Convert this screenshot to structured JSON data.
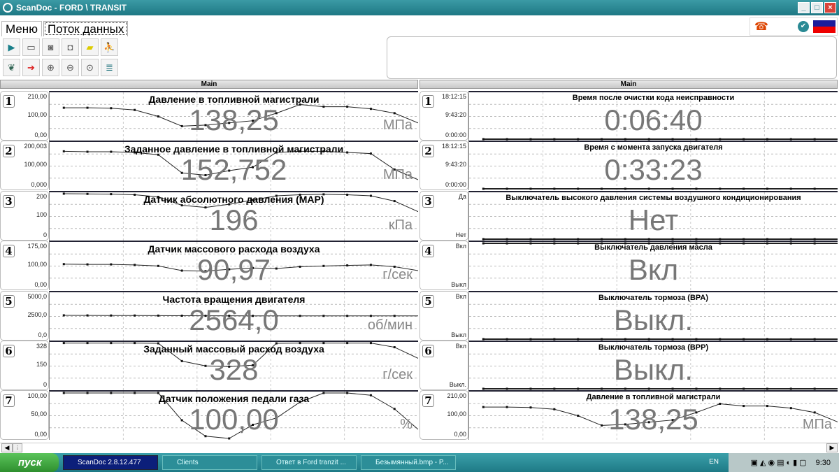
{
  "window": {
    "title": "ScanDoc - FORD \\ TRANSIT",
    "min": "_",
    "max": "□",
    "close": "×"
  },
  "tabs": [
    {
      "label": "Меню"
    },
    {
      "label": "Поток данных"
    }
  ],
  "toolbar1": [
    "play-icon",
    "save-icon",
    "record-icon",
    "camera-icon",
    "open-folder-icon",
    "person-icon"
  ],
  "toolbar2": [
    "leaf-icon",
    "export-icon",
    "zoom-in-icon",
    "zoom-out-icon",
    "zoom-fit-icon",
    "list-icon"
  ],
  "status": {
    "colors": {
      "flag_top": "#1c1c9c",
      "flag_bottom": "#e00000"
    }
  },
  "left": {
    "header": "Main",
    "panels": [
      {
        "n": "1",
        "title": "Давление в топливной магистрали",
        "value": "138,25",
        "unit": "МПа",
        "axis": [
          "210,00",
          "100,00",
          "0,00"
        ],
        "ymin": 0,
        "ymax": 210,
        "trace": [
          145,
          145,
          143,
          135,
          105,
          60,
          65,
          75,
          85,
          120,
          160,
          150,
          150,
          140,
          120,
          75
        ]
      },
      {
        "n": "2",
        "title": "Заданное давление в топливной магистрали",
        "value": "152,752",
        "unit": "МПа",
        "axis": [
          "200,003",
          "100,000",
          "0,000"
        ],
        "ymin": 0,
        "ymax": 200,
        "trace": [
          165,
          163,
          163,
          160,
          150,
          70,
          60,
          80,
          95,
          160,
          165,
          165,
          160,
          155,
          85,
          40
        ]
      },
      {
        "n": "3",
        "title": "Датчик абсолютного давления (MAP)",
        "value": "196",
        "unit": "кПа",
        "axis": [
          "200",
          "100",
          "0"
        ],
        "ymin": 0,
        "ymax": 215,
        "trace": [
          215,
          214,
          213,
          210,
          200,
          160,
          150,
          165,
          185,
          205,
          210,
          212,
          210,
          205,
          180,
          130
        ]
      },
      {
        "n": "4",
        "title": "Датчик массового расхода воздуха",
        "value": "90,97",
        "unit": "г/сек",
        "axis": [
          "175,00",
          "100,00",
          "0,00"
        ],
        "ymin": 0,
        "ymax": 175,
        "trace": [
          95,
          94,
          94,
          92,
          88,
          70,
          68,
          75,
          80,
          78,
          85,
          88,
          90,
          92,
          85,
          70
        ]
      },
      {
        "n": "5",
        "title": "Частота вращения двигателя",
        "value": "2564,0",
        "unit": "об/мин",
        "axis": [
          "5000,0",
          "2500,0",
          "0,0"
        ],
        "ymin": 0,
        "ymax": 5000,
        "trace": [
          2620,
          2610,
          2600,
          2600,
          2590,
          2580,
          2570,
          2570,
          2560,
          2560,
          2560,
          2560,
          2560,
          2560,
          2560,
          2560
        ]
      },
      {
        "n": "6",
        "title": "Заданный массовый расход воздуха",
        "value": "328",
        "unit": "г/сек",
        "axis": [
          "328",
          "150",
          "0"
        ],
        "ymin": 0,
        "ymax": 328,
        "trace": [
          330,
          330,
          330,
          330,
          328,
          200,
          165,
          160,
          170,
          328,
          330,
          330,
          330,
          330,
          300,
          220
        ]
      },
      {
        "n": "7",
        "title": "Датчик положения педали газа",
        "value": "100,00",
        "unit": "%",
        "axis": [
          "100,00",
          "50,00",
          "0,00"
        ],
        "ymin": 0,
        "ymax": 100,
        "trace": [
          100,
          100,
          100,
          100,
          100,
          40,
          5,
          0,
          30,
          45,
          80,
          100,
          100,
          95,
          65,
          20
        ]
      }
    ]
  },
  "right": {
    "header": "Main",
    "panels": [
      {
        "n": "1",
        "title": "Время после очистки кода неисправности",
        "value": "0:06:40",
        "unit": "",
        "axis": [
          "18:12:15",
          "9:43:20",
          "0:00:00"
        ],
        "ymin": 0,
        "ymax": 1,
        "trace": [
          0,
          0,
          0,
          0,
          0,
          0,
          0,
          0,
          0,
          0,
          0,
          0,
          0,
          0,
          0,
          0
        ]
      },
      {
        "n": "2",
        "title": "Время с момента запуска двигателя",
        "value": "0:33:23",
        "unit": "",
        "axis": [
          "18:12:15",
          "9:43:20",
          "0:00:00"
        ],
        "ymin": 0,
        "ymax": 1,
        "trace": [
          0,
          0,
          0,
          0,
          0,
          0,
          0,
          0,
          0,
          0,
          0,
          0,
          0,
          0,
          0,
          0
        ]
      },
      {
        "n": "3",
        "title": "Выключатель высокого давления системы воздушного кондиционирования",
        "value": "Нет",
        "unit": "",
        "axis": [
          "Да",
          "",
          "Нет"
        ],
        "ymin": 0,
        "ymax": 1,
        "trace": [
          0,
          0,
          0,
          0,
          0,
          0,
          0,
          0,
          0,
          0,
          0,
          0,
          0,
          0,
          0,
          0
        ]
      },
      {
        "n": "4",
        "title": "Выключатель давления масла",
        "value": "Вкл",
        "unit": "",
        "axis": [
          "Вкл",
          "",
          "Выкл"
        ],
        "ymin": 0,
        "ymax": 1,
        "trace": [
          1,
          1,
          1,
          1,
          1,
          1,
          1,
          1,
          1,
          1,
          1,
          1,
          1,
          1,
          1,
          1
        ]
      },
      {
        "n": "5",
        "title": "Выключатель тормоза (BPA)",
        "value": "Выкл.",
        "unit": "",
        "axis": [
          "Вкл",
          "",
          "Выкл"
        ],
        "ymin": 0,
        "ymax": 1,
        "trace": [
          0,
          0,
          0,
          0,
          0,
          0,
          0,
          0,
          0,
          0,
          0,
          0,
          0,
          0,
          0,
          0
        ]
      },
      {
        "n": "6",
        "title": "Выключатель тормоза (BPP)",
        "value": "Выкл.",
        "unit": "",
        "axis": [
          "Вкл",
          "",
          "Выкл."
        ],
        "ymin": 0,
        "ymax": 1,
        "trace": [
          0,
          0,
          0,
          0,
          0,
          0,
          0,
          0,
          0,
          0,
          0,
          0,
          0,
          0,
          0,
          0
        ]
      },
      {
        "n": "7",
        "title": "Давление в топливной магистрали",
        "value": "138,25",
        "unit": "МПа",
        "axis": [
          "210,00",
          "100,00",
          "0,00"
        ],
        "ymin": 0,
        "ymax": 210,
        "trace": [
          145,
          145,
          143,
          135,
          105,
          60,
          65,
          75,
          85,
          120,
          160,
          150,
          150,
          140,
          120,
          75
        ]
      }
    ]
  },
  "taskbar": {
    "start": "пуск",
    "tasks": [
      "ScanDoc 2.8.12.477",
      "Clients",
      "Ответ в Ford tranzit ...",
      "Безымянный.bmp - P..."
    ],
    "lang": "EN",
    "clock": "9:30"
  }
}
